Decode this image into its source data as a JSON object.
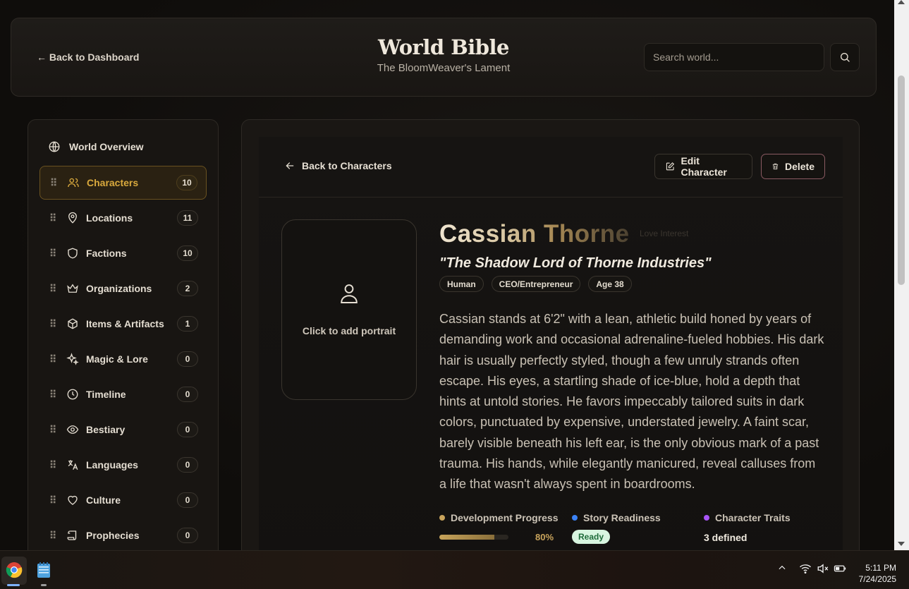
{
  "header": {
    "back_label": "← Back to Dashboard",
    "title": "World Bible",
    "subtitle": "The BloomWeaver's Lament",
    "search_placeholder": "Search world..."
  },
  "sidebar": {
    "overview_label": "World Overview",
    "items": [
      {
        "label": "Characters",
        "count": "10",
        "icon": "users-icon",
        "active": true
      },
      {
        "label": "Locations",
        "count": "11",
        "icon": "map-pin-icon"
      },
      {
        "label": "Factions",
        "count": "10",
        "icon": "shield-icon"
      },
      {
        "label": "Organizations",
        "count": "2",
        "icon": "crown-icon"
      },
      {
        "label": "Items & Artifacts",
        "count": "1",
        "icon": "box-icon"
      },
      {
        "label": "Magic & Lore",
        "count": "0",
        "icon": "sparkles-icon"
      },
      {
        "label": "Timeline",
        "count": "0",
        "icon": "clock-icon"
      },
      {
        "label": "Bestiary",
        "count": "0",
        "icon": "eye-icon"
      },
      {
        "label": "Languages",
        "count": "0",
        "icon": "languages-icon"
      },
      {
        "label": "Culture",
        "count": "0",
        "icon": "heart-icon"
      },
      {
        "label": "Prophecies",
        "count": "0",
        "icon": "scroll-icon"
      }
    ]
  },
  "character": {
    "back_label": "Back to Characters",
    "edit_label": "Edit Character",
    "delete_label": "Delete",
    "portrait_label": "Click to add portrait",
    "name": "Cassian Thorne",
    "ghost_text": "Love Interest",
    "title": "\"The Shadow Lord of Thorne Industries\"",
    "tags": [
      "Human",
      "CEO/Entrepreneur",
      "Age 38"
    ],
    "description": "Cassian stands at 6'2\" with a lean, athletic build honed by years of demanding work and occasional adrenaline-fueled hobbies. His dark hair is usually perfectly styled, though a few unruly strands often escape. His eyes, a startling shade of ice-blue, hold a depth that hints at untold stories. He favors impeccably tailored suits in dark colors, punctuated by expensive, understated jewelry. A faint scar, barely visible beneath his left ear, is the only obvious mark of a past trauma. His hands, while elegantly manicured, reveal calluses from a life that wasn't always spent in boardrooms.",
    "stats": {
      "development_label": "Development Progress",
      "development_percent": 80,
      "development_text": "80%",
      "readiness_label": "Story Readiness",
      "readiness_value": "Ready",
      "traits_label": "Character Traits",
      "traits_value": "3 defined"
    }
  },
  "taskbar": {
    "time": "5:11 PM",
    "date": "7/24/2025"
  },
  "colors": {
    "accent_gold": "#d9a93d",
    "dot_development": "#c9a45c",
    "dot_readiness": "#3b82f6",
    "dot_traits": "#a855f7",
    "delete_border": "#8a5a62",
    "ready_bg": "#d8f5e0"
  }
}
